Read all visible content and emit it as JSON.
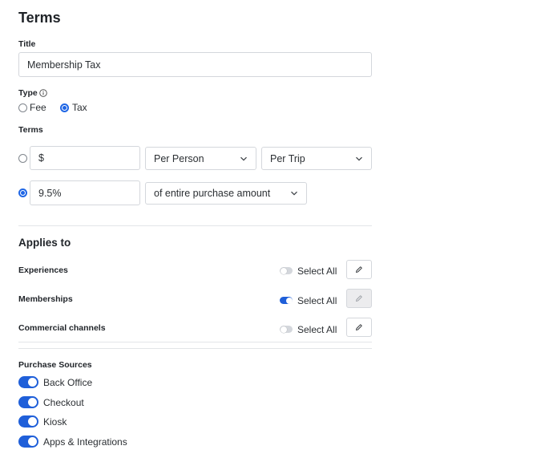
{
  "page": {
    "title": "Terms"
  },
  "title_field": {
    "label": "Title",
    "value": "Membership Tax"
  },
  "type_field": {
    "label": "Type",
    "info_icon": "info-icon",
    "options": [
      {
        "label": "Fee",
        "selected": false
      },
      {
        "label": "Tax",
        "selected": true
      }
    ]
  },
  "terms": {
    "label": "Terms",
    "fixed": {
      "selected": false,
      "amount_value": "$",
      "per_unit": "Per Person",
      "per_period": "Per Trip"
    },
    "percent": {
      "selected": true,
      "amount_value": "9.5%",
      "basis": "of entire purchase amount"
    }
  },
  "applies_to": {
    "title": "Applies to",
    "rows": [
      {
        "label": "Experiences",
        "select_all_label": "Select All",
        "select_all_on": false,
        "edit_enabled": true
      },
      {
        "label": "Memberships",
        "select_all_label": "Select All",
        "select_all_on": true,
        "edit_enabled": false
      },
      {
        "label": "Commercial channels",
        "select_all_label": "Select All",
        "select_all_on": false,
        "edit_enabled": true
      }
    ]
  },
  "purchase_sources": {
    "title": "Purchase Sources",
    "items": [
      {
        "label": "Back Office",
        "on": true
      },
      {
        "label": "Checkout",
        "on": true
      },
      {
        "label": "Kiosk",
        "on": true
      },
      {
        "label": "Apps & Integrations",
        "on": true
      }
    ]
  },
  "colors": {
    "accent": "#1f5fd9",
    "border": "#d4d7dc",
    "text": "#1f2328"
  }
}
